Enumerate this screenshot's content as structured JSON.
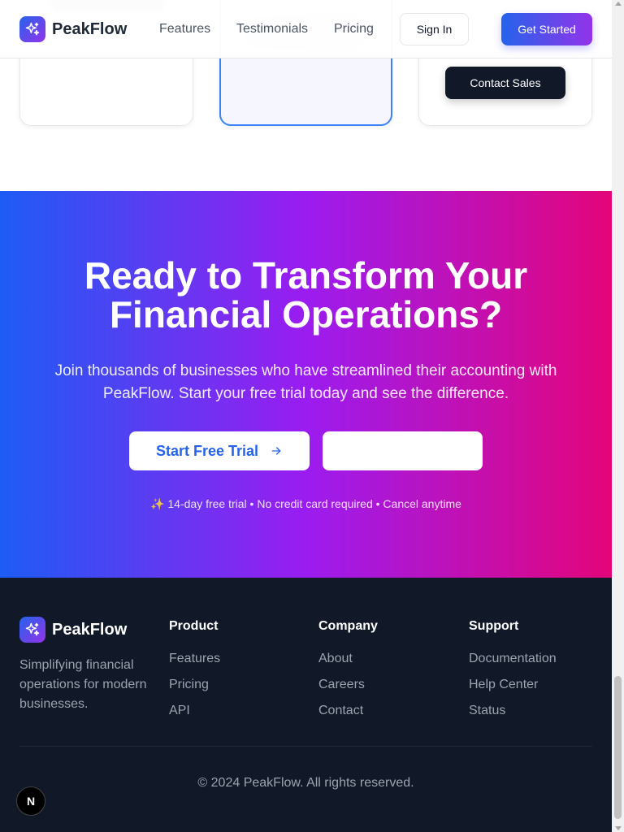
{
  "header": {
    "brand": "PeakFlow",
    "nav": [
      "Features",
      "Testimonials",
      "Pricing"
    ],
    "sign_in": "Sign In",
    "get_started": "Get Started"
  },
  "pricing": {
    "contact_sales": "Contact Sales"
  },
  "cta": {
    "title": "Ready to Transform Your Financial Operations?",
    "subtitle": "Join thousands of businesses who have streamlined their accounting with PeakFlow. Start your free trial today and see the difference.",
    "primary_button": "Start Free Trial",
    "note": "✨ 14-day free trial • No credit card required • Cancel anytime"
  },
  "footer": {
    "brand": "PeakFlow",
    "tagline": "Simplifying financial operations for modern businesses.",
    "columns": [
      {
        "title": "Product",
        "links": [
          "Features",
          "Pricing",
          "API"
        ]
      },
      {
        "title": "Company",
        "links": [
          "About",
          "Careers",
          "Contact"
        ]
      },
      {
        "title": "Support",
        "links": [
          "Documentation",
          "Help Center",
          "Status"
        ]
      }
    ],
    "copyright": "© 2024 PeakFlow. All rights reserved."
  },
  "badge": {
    "letter": "N"
  },
  "colors": {
    "brand_blue": "#2563eb",
    "brand_purple": "#9333ea",
    "cta_pink": "#e4057a",
    "footer_bg": "#111827"
  },
  "icons": {
    "logo": "sparkles-icon",
    "trial_button": "arrow-right-icon"
  }
}
